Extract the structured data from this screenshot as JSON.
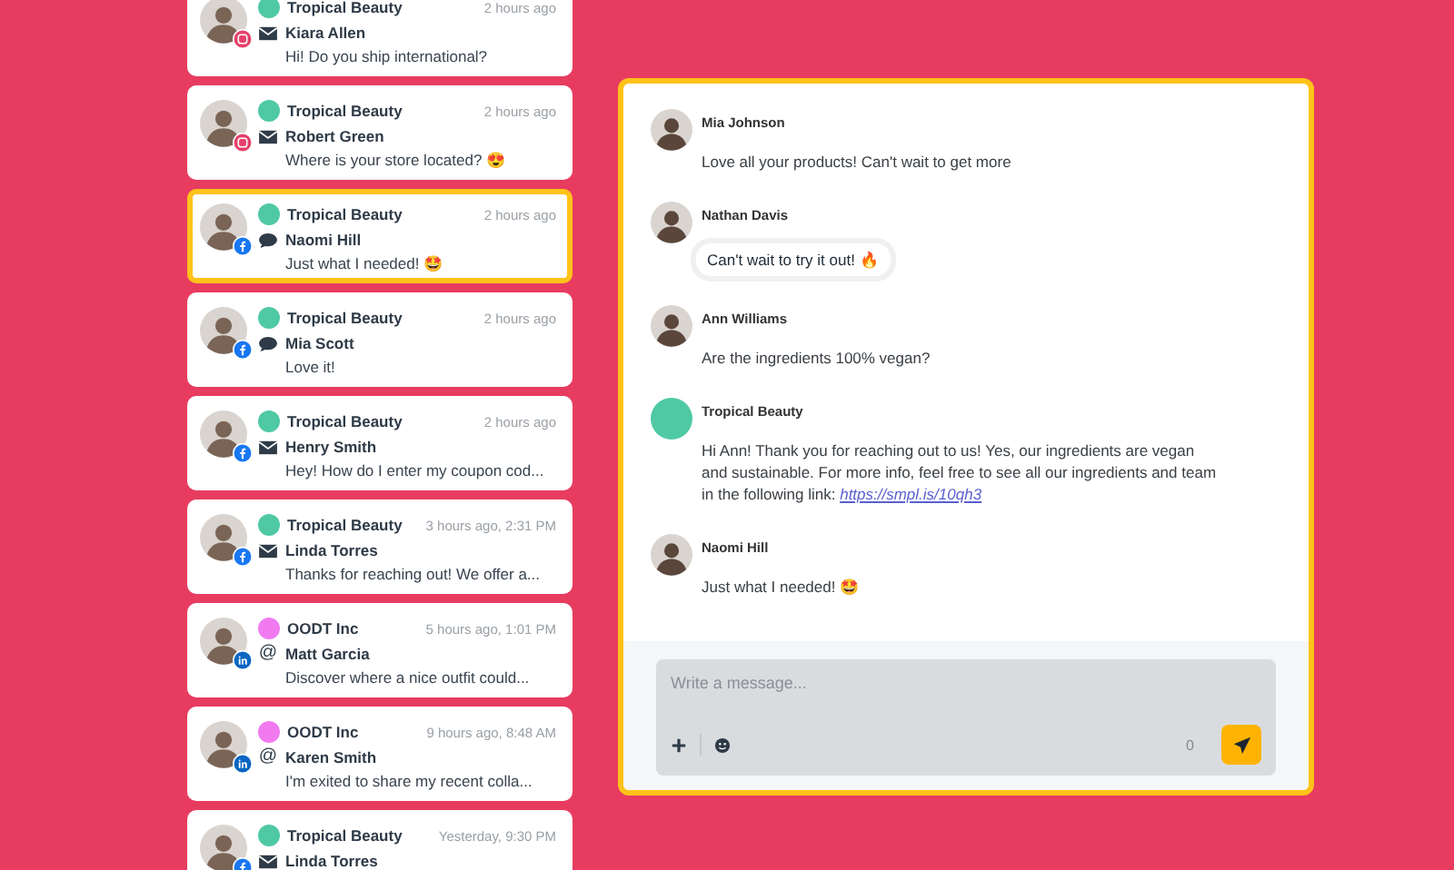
{
  "conversations": [
    {
      "brand": "Tropical Beauty",
      "color": "#4fc9a4",
      "time": "2 hours ago",
      "name": "Kiara Allen",
      "channel": {
        "kind": "email"
      },
      "network": {
        "kind": "instagram"
      },
      "message": "Hi! Do you ship international?",
      "selected": false
    },
    {
      "brand": "Tropical Beauty",
      "color": "#4fc9a4",
      "time": "2 hours ago",
      "name": "Robert Green",
      "channel": {
        "kind": "email"
      },
      "network": {
        "kind": "instagram"
      },
      "message": "Where is your store located? 😍",
      "selected": false
    },
    {
      "brand": "Tropical Beauty",
      "color": "#4fc9a4",
      "time": "2 hours ago",
      "name": "Naomi Hill",
      "channel": {
        "kind": "chat"
      },
      "network": {
        "kind": "facebook"
      },
      "message": "Just what I needed! 🤩",
      "selected": true
    },
    {
      "brand": "Tropical Beauty",
      "color": "#4fc9a4",
      "time": "2 hours ago",
      "name": "Mia Scott",
      "channel": {
        "kind": "chat"
      },
      "network": {
        "kind": "facebook"
      },
      "message": "Love it!",
      "selected": false
    },
    {
      "brand": "Tropical Beauty",
      "color": "#4fc9a4",
      "time": "2 hours ago",
      "name": "Henry Smith",
      "channel": {
        "kind": "email"
      },
      "network": {
        "kind": "facebook"
      },
      "message": "Hey! How do I enter my coupon cod...",
      "selected": false
    },
    {
      "brand": "Tropical Beauty",
      "color": "#4fc9a4",
      "time": "3 hours ago, 2:31 PM",
      "name": "Linda Torres",
      "channel": {
        "kind": "email"
      },
      "network": {
        "kind": "facebook"
      },
      "message": "Thanks for reaching out! We offer a...",
      "selected": false
    },
    {
      "brand": "OODT Inc",
      "color": "#f27af0",
      "time": "5 hours ago, 1:01 PM",
      "name": "Matt Garcia",
      "channel": {
        "kind": "mention",
        "glyph": "@"
      },
      "network": {
        "kind": "linkedin"
      },
      "message": "Discover where a nice outfit  could...",
      "selected": false
    },
    {
      "brand": "OODT Inc",
      "color": "#f27af0",
      "time": "9 hours ago, 8:48 AM",
      "name": "Karen Smith",
      "channel": {
        "kind": "mention",
        "glyph": "@"
      },
      "network": {
        "kind": "linkedin"
      },
      "message": "I'm exited to share my recent colla...",
      "selected": false
    },
    {
      "brand": "Tropical Beauty",
      "color": "#4fc9a4",
      "time": "Yesterday, 9:30 PM",
      "name": "Linda Torres",
      "channel": {
        "kind": "email"
      },
      "network": {
        "kind": "facebook"
      },
      "selected": false
    }
  ],
  "chat": {
    "messages": [
      {
        "author": "Mia Johnson",
        "avatar": {
          "kind": "photo"
        },
        "text": "Love all your products! Can't wait to get more",
        "highlighted": false
      },
      {
        "author": "Nathan Davis",
        "avatar": {
          "kind": "photo"
        },
        "text": "Can't wait to try it out! 🔥",
        "highlighted": true
      },
      {
        "author": "Ann Williams",
        "avatar": {
          "kind": "photo"
        },
        "text": "Are the ingredients 100% vegan?",
        "highlighted": false
      },
      {
        "author": "Tropical Beauty",
        "avatar": {
          "kind": "brand",
          "color": "#4fc9a4"
        },
        "text": "Hi Ann! Thank you for reaching out to us! Yes, our ingredients are vegan and sustainable. For more info, feel free to see all our ingredients and team in the following link:",
        "link": "https://smpl.is/10qh3",
        "highlighted": false
      },
      {
        "author": "Naomi Hill",
        "avatar": {
          "kind": "photo"
        },
        "text": "Just what I needed! 🤩",
        "highlighted": false
      }
    ],
    "composer": {
      "placeholder": "Write a message...",
      "count": "0"
    }
  }
}
